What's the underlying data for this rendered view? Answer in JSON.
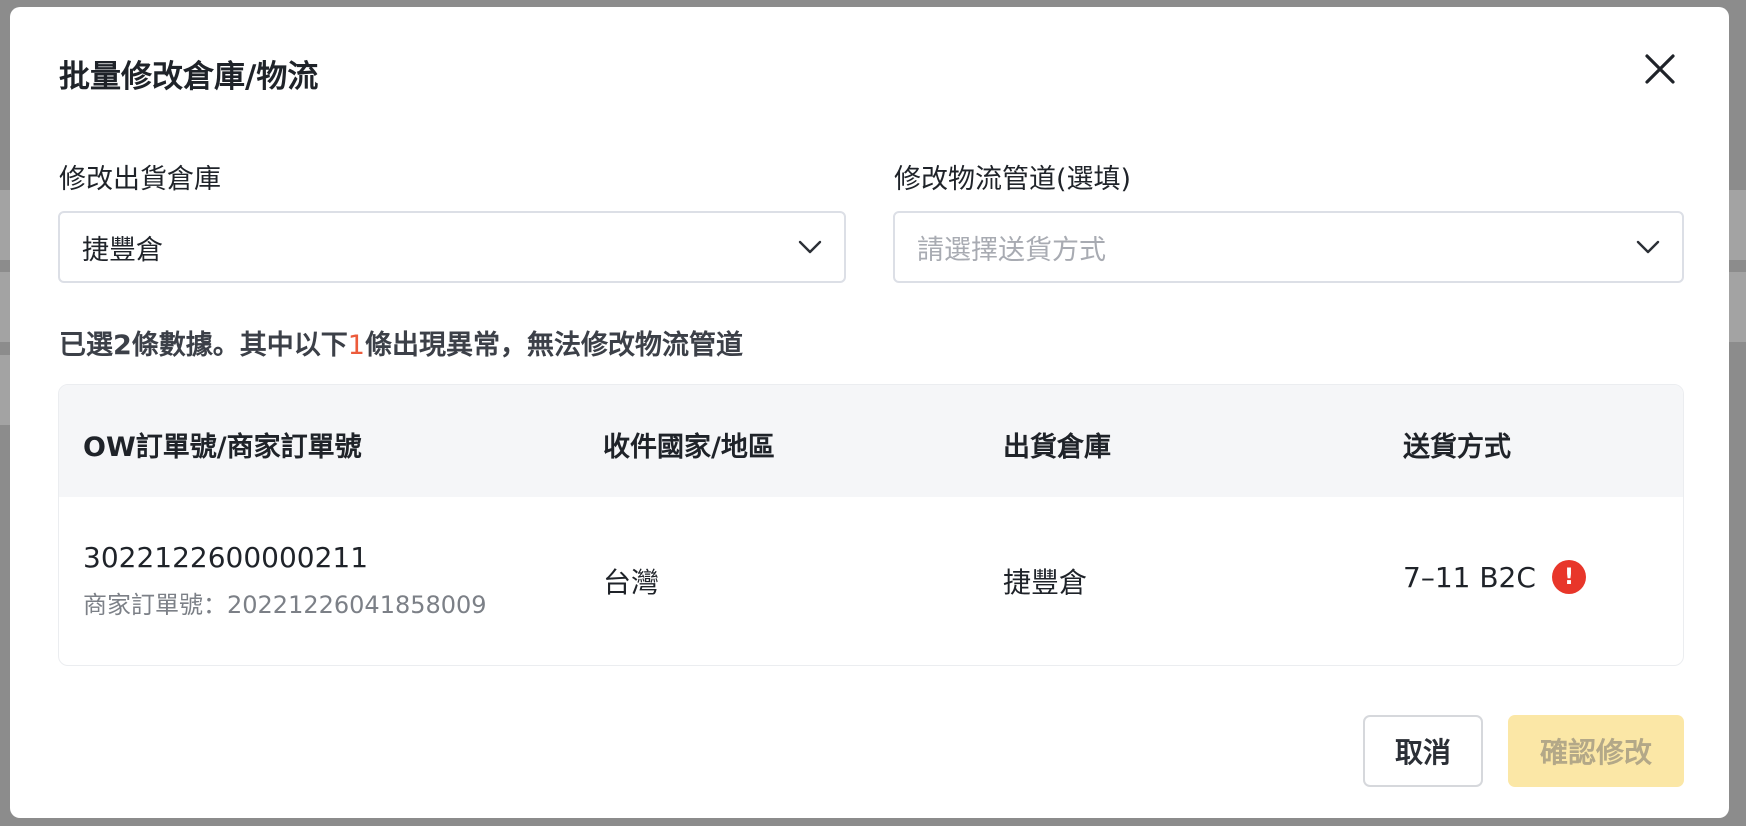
{
  "modal": {
    "title": "批量修改倉庫/物流",
    "close_icon": "close-icon"
  },
  "warehouse_field": {
    "label": "修改出貨倉庫",
    "value": "捷豐倉"
  },
  "logistics_field": {
    "label": "修改物流管道(選填)",
    "placeholder": "請選擇送貨方式"
  },
  "notice": {
    "prefix": "已選2條數據。其中以下",
    "count": "1",
    "suffix": "條出現異常，無法修改物流管道"
  },
  "table": {
    "headers": [
      "OW訂單號/商家訂單號",
      "收件國家/地區",
      "出貨倉庫",
      "送貨方式"
    ],
    "rows": [
      {
        "order_no": "3022122600000211",
        "merchant_order": "商家訂單號：20221226041858009",
        "country": "台灣",
        "warehouse": "捷豐倉",
        "delivery": "7–11 B2C",
        "warning_icon": "exclamation-circle-icon"
      }
    ]
  },
  "buttons": {
    "cancel": "取消",
    "confirm": "確認修改"
  },
  "colors": {
    "accent_warning": "#e8362a",
    "count_highlight": "#ec5b3b",
    "confirm_disabled_bg": "#fbe7a6"
  }
}
